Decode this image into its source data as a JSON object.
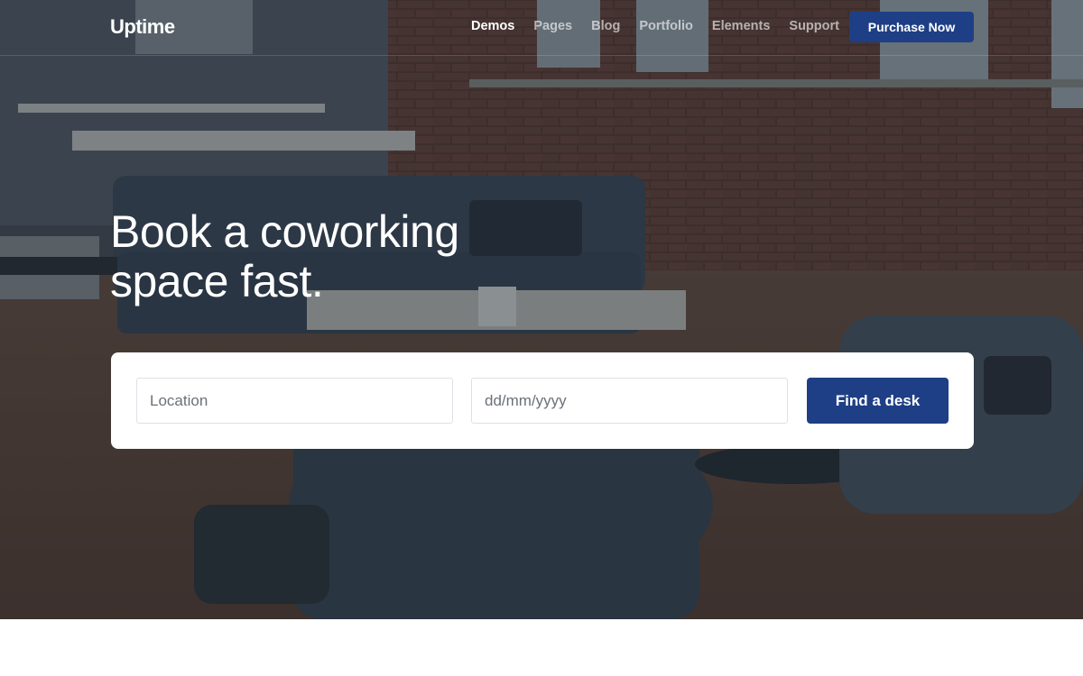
{
  "brand": {
    "name": "Uptime"
  },
  "nav": {
    "items": [
      {
        "label": "Demos",
        "active": true
      },
      {
        "label": "Pages",
        "active": false
      },
      {
        "label": "Blog",
        "active": false
      },
      {
        "label": "Portfolio",
        "active": false
      },
      {
        "label": "Elements",
        "active": false
      },
      {
        "label": "Support",
        "active": false
      }
    ],
    "cta_label": "Purchase Now"
  },
  "hero": {
    "title_line1": "Book a coworking",
    "title_line2": "space fast.",
    "background": "coworking-space-photo"
  },
  "search": {
    "location_placeholder": "Location",
    "location_value": "",
    "date_placeholder": "dd/mm/yyyy",
    "date_value": "",
    "submit_label": "Find a desk"
  },
  "colors": {
    "accent": "#1e3f85",
    "card": "#ffffff",
    "overlay": "#141e2a"
  }
}
